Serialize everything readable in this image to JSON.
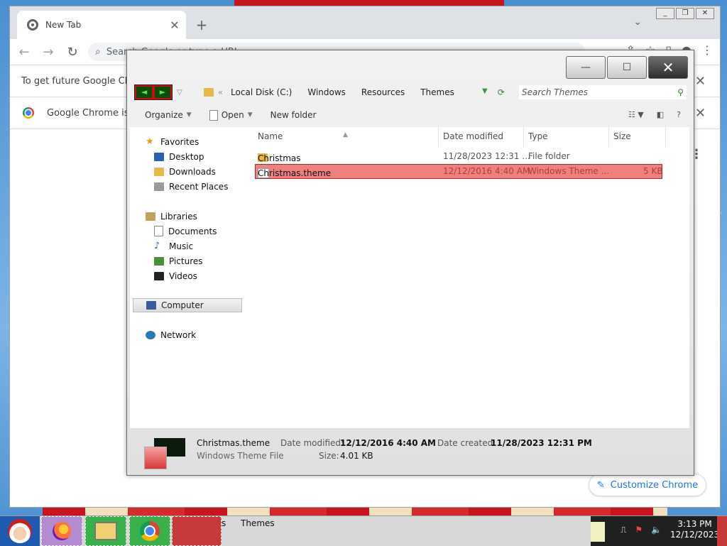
{
  "chrome": {
    "tab_title": "New Tab",
    "tab_close": "✕",
    "new_tab": "+",
    "omnibox_placeholder": "Search Google or type a URL",
    "infobar1_text": "To get future Google Chrome",
    "infobar2_text": "Google Chrome isn't",
    "infobar_close": "✕",
    "customize_label": "Customize Chrome",
    "kebab": "⋮"
  },
  "explorer": {
    "window_buttons": {
      "minimize": "—",
      "maximize": "☐",
      "close": "✕"
    },
    "breadcrumb": [
      "Local Disk (C:)",
      "Windows",
      "Resources",
      "Themes"
    ],
    "breadcrumb_prefix": "«",
    "search_placeholder": "Search Themes",
    "commands": {
      "organize": "Organize",
      "open": "Open",
      "new_folder": "New folder"
    },
    "nav": {
      "favorites": {
        "label": "Favorites",
        "items": [
          "Desktop",
          "Downloads",
          "Recent Places"
        ]
      },
      "libraries": {
        "label": "Libraries",
        "items": [
          "Documents",
          "Music",
          "Pictures",
          "Videos"
        ]
      },
      "computer": "Computer",
      "network": "Network"
    },
    "columns": {
      "name": "Name",
      "date": "Date modified",
      "type": "Type",
      "size": "Size"
    },
    "files": [
      {
        "name": "Christmas",
        "date": "11/28/2023 12:31 ...",
        "type": "File folder",
        "size": ""
      },
      {
        "name": "Christmas.theme",
        "date": "12/12/2016 4:40 AM",
        "type": "Windows Theme ...",
        "size": "5 KB"
      }
    ],
    "details": {
      "name": "Christmas.theme",
      "type": "Windows Theme File",
      "modified_label": "Date modified:",
      "modified_value": "12/12/2016 4:40 AM",
      "created_label": "Date created:",
      "created_value": "11/28/2023 12:31 PM",
      "size_label": "Size:",
      "size_value": "4.01 KB"
    }
  },
  "taskbar": {
    "label_cut": "s",
    "label": "Themes",
    "time": "3:13 PM",
    "date": "12/12/2023"
  }
}
